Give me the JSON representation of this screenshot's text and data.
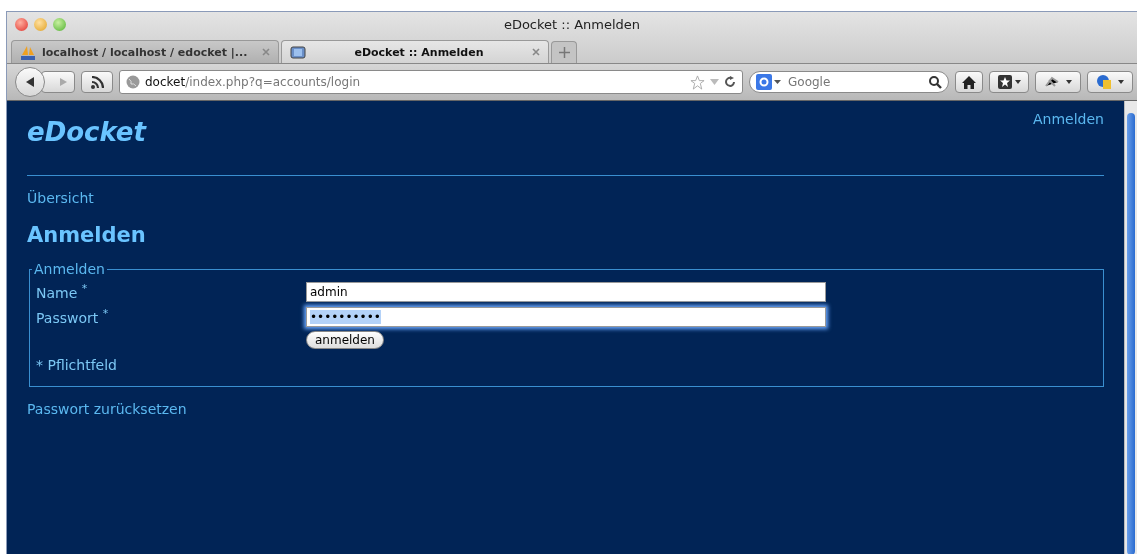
{
  "window": {
    "title": "eDocket :: Anmelden"
  },
  "tabs": [
    {
      "label": "localhost / localhost / edocket |...",
      "selected": false
    },
    {
      "label": "eDocket :: Anmelden",
      "selected": true
    }
  ],
  "address_bar": {
    "domain": "docket",
    "path": "/index.php?q=accounts/login"
  },
  "search": {
    "placeholder": "Google"
  },
  "page": {
    "logo": "eDocket",
    "top_link": "Anmelden",
    "breadcrumb": "Übersicht",
    "heading": "Anmelden",
    "form": {
      "legend": "Anmelden",
      "fields": [
        {
          "label": "Name",
          "required_mark": "*",
          "value": "admin",
          "focused": false,
          "selected_text": false
        },
        {
          "label": "Passwort",
          "required_mark": "*",
          "value": "••••••••••",
          "focused": true,
          "selected_text": true
        }
      ],
      "submit": "anmelden",
      "note": "* Pflichtfeld"
    },
    "footer_link": "Passwort zurücksetzen"
  }
}
